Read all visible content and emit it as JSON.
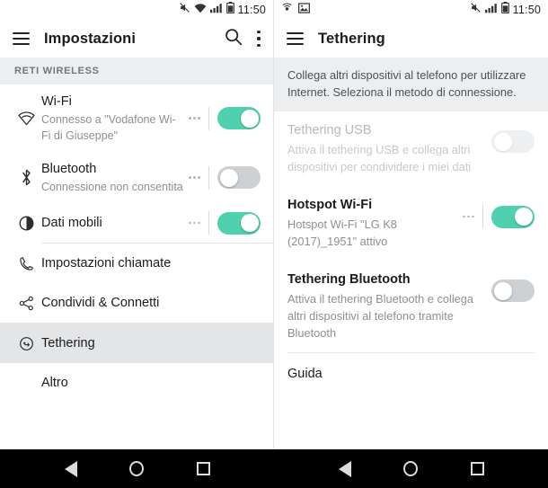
{
  "left": {
    "statusbar": {
      "icons": [
        "mute-icon",
        "wifi-icon",
        "signal-icon",
        "battery-icon"
      ],
      "time": "11:50"
    },
    "appbar": {
      "title": "Impostazioni",
      "menu_icon": "hamburger-icon",
      "search_icon": "search-icon",
      "overflow_icon": "kebab-icon"
    },
    "section_header": "RETI WIRELESS",
    "items": [
      {
        "icon": "wifi-icon",
        "title": "Wi-Fi",
        "sub": "Connesso a \"Vodafone Wi-Fi di Giuseppe\"",
        "toggle": "on",
        "has_dots": true
      },
      {
        "icon": "bluetooth-icon",
        "title": "Bluetooth",
        "sub": "Connessione non consentita",
        "toggle": "off",
        "has_dots": true
      },
      {
        "icon": "mobile-data-icon",
        "title": "Dati mobili",
        "sub": "",
        "toggle": "on",
        "has_dots": true
      },
      {
        "icon": "phone-icon",
        "title": "Impostazioni chiamate",
        "sub": "",
        "toggle": "none",
        "has_dots": false
      },
      {
        "icon": "share-icon",
        "title": "Condividi & Connetti",
        "sub": "",
        "toggle": "none",
        "has_dots": false
      },
      {
        "icon": "tethering-icon",
        "title": "Tethering",
        "sub": "",
        "toggle": "none",
        "has_dots": false,
        "selected": true
      },
      {
        "icon": "none",
        "title": "Altro",
        "sub": "",
        "toggle": "none",
        "has_dots": false
      }
    ]
  },
  "right": {
    "statusbar": {
      "left_icons": [
        "hotspot-icon",
        "screenshot-icon"
      ],
      "icons": [
        "mute-icon",
        "signal-icon",
        "battery-icon"
      ],
      "time": "11:50"
    },
    "appbar": {
      "title": "Tethering",
      "menu_icon": "hamburger-icon"
    },
    "description": "Collega altri dispositivi al telefono per utilizzare Internet. Seleziona il metodo di connessione.",
    "sections": [
      {
        "title": "Tethering USB",
        "sub": "Attiva il tethering USB e collega altri dispositivi per condividere i miei dati",
        "toggle": "dim",
        "disabled": true,
        "has_dots": false
      },
      {
        "title": "Hotspot Wi-Fi",
        "sub": "Hotspot Wi-Fi \"LG K8 (2017)_1951\" attivo",
        "toggle": "on",
        "disabled": false,
        "has_dots": true
      },
      {
        "title": "Tethering Bluetooth",
        "sub": "Attiva il tethering Bluetooth e collega altri dispositivi al telefono tramite Bluetooth",
        "toggle": "off",
        "disabled": false,
        "has_dots": false
      }
    ],
    "guida": "Guida"
  },
  "navbar": {
    "back": "back-icon",
    "home": "home-icon",
    "recents": "recents-icon"
  },
  "colors": {
    "accent_on": "#4fd1b0",
    "toggle_off": "#cdd1d4",
    "section_bg": "#eceef0",
    "selected_row": "#e3e5e7"
  }
}
